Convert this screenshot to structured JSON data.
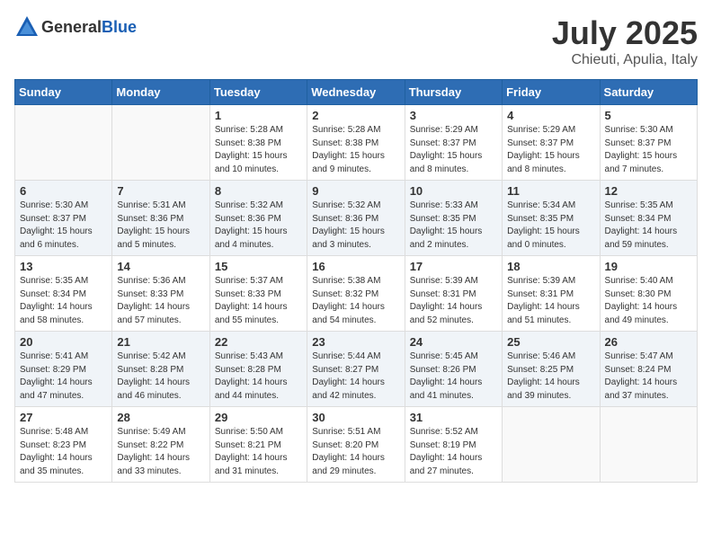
{
  "header": {
    "logo_general": "General",
    "logo_blue": "Blue",
    "month": "July 2025",
    "location": "Chieuti, Apulia, Italy"
  },
  "weekdays": [
    "Sunday",
    "Monday",
    "Tuesday",
    "Wednesday",
    "Thursday",
    "Friday",
    "Saturday"
  ],
  "weeks": [
    [
      {
        "day": "",
        "info": ""
      },
      {
        "day": "",
        "info": ""
      },
      {
        "day": "1",
        "info": "Sunrise: 5:28 AM\nSunset: 8:38 PM\nDaylight: 15 hours and 10 minutes."
      },
      {
        "day": "2",
        "info": "Sunrise: 5:28 AM\nSunset: 8:38 PM\nDaylight: 15 hours and 9 minutes."
      },
      {
        "day": "3",
        "info": "Sunrise: 5:29 AM\nSunset: 8:37 PM\nDaylight: 15 hours and 8 minutes."
      },
      {
        "day": "4",
        "info": "Sunrise: 5:29 AM\nSunset: 8:37 PM\nDaylight: 15 hours and 8 minutes."
      },
      {
        "day": "5",
        "info": "Sunrise: 5:30 AM\nSunset: 8:37 PM\nDaylight: 15 hours and 7 minutes."
      }
    ],
    [
      {
        "day": "6",
        "info": "Sunrise: 5:30 AM\nSunset: 8:37 PM\nDaylight: 15 hours and 6 minutes."
      },
      {
        "day": "7",
        "info": "Sunrise: 5:31 AM\nSunset: 8:36 PM\nDaylight: 15 hours and 5 minutes."
      },
      {
        "day": "8",
        "info": "Sunrise: 5:32 AM\nSunset: 8:36 PM\nDaylight: 15 hours and 4 minutes."
      },
      {
        "day": "9",
        "info": "Sunrise: 5:32 AM\nSunset: 8:36 PM\nDaylight: 15 hours and 3 minutes."
      },
      {
        "day": "10",
        "info": "Sunrise: 5:33 AM\nSunset: 8:35 PM\nDaylight: 15 hours and 2 minutes."
      },
      {
        "day": "11",
        "info": "Sunrise: 5:34 AM\nSunset: 8:35 PM\nDaylight: 15 hours and 0 minutes."
      },
      {
        "day": "12",
        "info": "Sunrise: 5:35 AM\nSunset: 8:34 PM\nDaylight: 14 hours and 59 minutes."
      }
    ],
    [
      {
        "day": "13",
        "info": "Sunrise: 5:35 AM\nSunset: 8:34 PM\nDaylight: 14 hours and 58 minutes."
      },
      {
        "day": "14",
        "info": "Sunrise: 5:36 AM\nSunset: 8:33 PM\nDaylight: 14 hours and 57 minutes."
      },
      {
        "day": "15",
        "info": "Sunrise: 5:37 AM\nSunset: 8:33 PM\nDaylight: 14 hours and 55 minutes."
      },
      {
        "day": "16",
        "info": "Sunrise: 5:38 AM\nSunset: 8:32 PM\nDaylight: 14 hours and 54 minutes."
      },
      {
        "day": "17",
        "info": "Sunrise: 5:39 AM\nSunset: 8:31 PM\nDaylight: 14 hours and 52 minutes."
      },
      {
        "day": "18",
        "info": "Sunrise: 5:39 AM\nSunset: 8:31 PM\nDaylight: 14 hours and 51 minutes."
      },
      {
        "day": "19",
        "info": "Sunrise: 5:40 AM\nSunset: 8:30 PM\nDaylight: 14 hours and 49 minutes."
      }
    ],
    [
      {
        "day": "20",
        "info": "Sunrise: 5:41 AM\nSunset: 8:29 PM\nDaylight: 14 hours and 47 minutes."
      },
      {
        "day": "21",
        "info": "Sunrise: 5:42 AM\nSunset: 8:28 PM\nDaylight: 14 hours and 46 minutes."
      },
      {
        "day": "22",
        "info": "Sunrise: 5:43 AM\nSunset: 8:28 PM\nDaylight: 14 hours and 44 minutes."
      },
      {
        "day": "23",
        "info": "Sunrise: 5:44 AM\nSunset: 8:27 PM\nDaylight: 14 hours and 42 minutes."
      },
      {
        "day": "24",
        "info": "Sunrise: 5:45 AM\nSunset: 8:26 PM\nDaylight: 14 hours and 41 minutes."
      },
      {
        "day": "25",
        "info": "Sunrise: 5:46 AM\nSunset: 8:25 PM\nDaylight: 14 hours and 39 minutes."
      },
      {
        "day": "26",
        "info": "Sunrise: 5:47 AM\nSunset: 8:24 PM\nDaylight: 14 hours and 37 minutes."
      }
    ],
    [
      {
        "day": "27",
        "info": "Sunrise: 5:48 AM\nSunset: 8:23 PM\nDaylight: 14 hours and 35 minutes."
      },
      {
        "day": "28",
        "info": "Sunrise: 5:49 AM\nSunset: 8:22 PM\nDaylight: 14 hours and 33 minutes."
      },
      {
        "day": "29",
        "info": "Sunrise: 5:50 AM\nSunset: 8:21 PM\nDaylight: 14 hours and 31 minutes."
      },
      {
        "day": "30",
        "info": "Sunrise: 5:51 AM\nSunset: 8:20 PM\nDaylight: 14 hours and 29 minutes."
      },
      {
        "day": "31",
        "info": "Sunrise: 5:52 AM\nSunset: 8:19 PM\nDaylight: 14 hours and 27 minutes."
      },
      {
        "day": "",
        "info": ""
      },
      {
        "day": "",
        "info": ""
      }
    ]
  ]
}
